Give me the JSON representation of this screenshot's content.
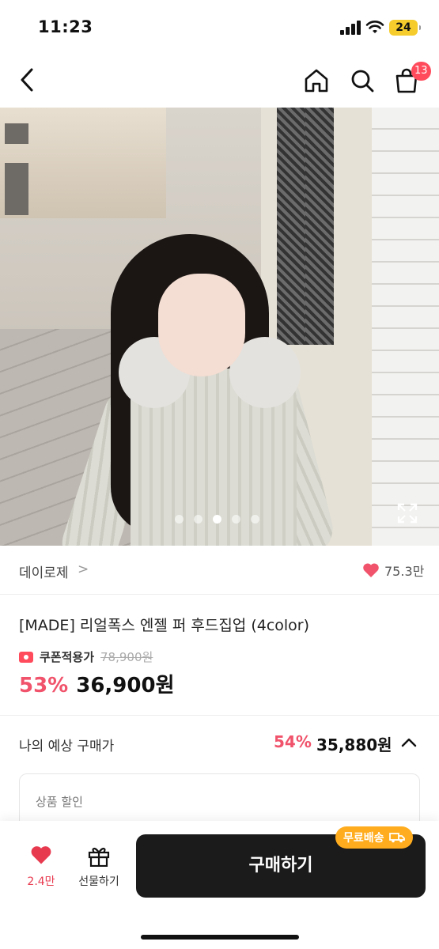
{
  "status_bar": {
    "time": "11:23",
    "battery": "24"
  },
  "nav": {
    "cart_count": "13"
  },
  "gallery": {
    "total": 5,
    "current": 3
  },
  "brand": {
    "name": "데이로제",
    "chevron": ">",
    "likes": "75.3만"
  },
  "product": {
    "title": "[MADE] 리얼폭스 엔젤 퍼 후드집업 (4color)",
    "coupon_label": "쿠폰적용가",
    "original_price": "78,900원",
    "discount": "53%",
    "price": "36,900원"
  },
  "expected": {
    "label": "나의 예상 구매가",
    "discount": "54%",
    "price": "35,880원"
  },
  "detail": {
    "label": "상품 할인"
  },
  "bottom_bar": {
    "heart_count": "2.4만",
    "gift_label": "선물하기",
    "buy_label": "구매하기",
    "free_shipping": "무료배송"
  },
  "colors": {
    "accent": "#f0536b",
    "heart": "#e83a4f",
    "badge": "#ff4b5c",
    "shipping": "#ffad1f",
    "buy": "#1b1b1b"
  }
}
